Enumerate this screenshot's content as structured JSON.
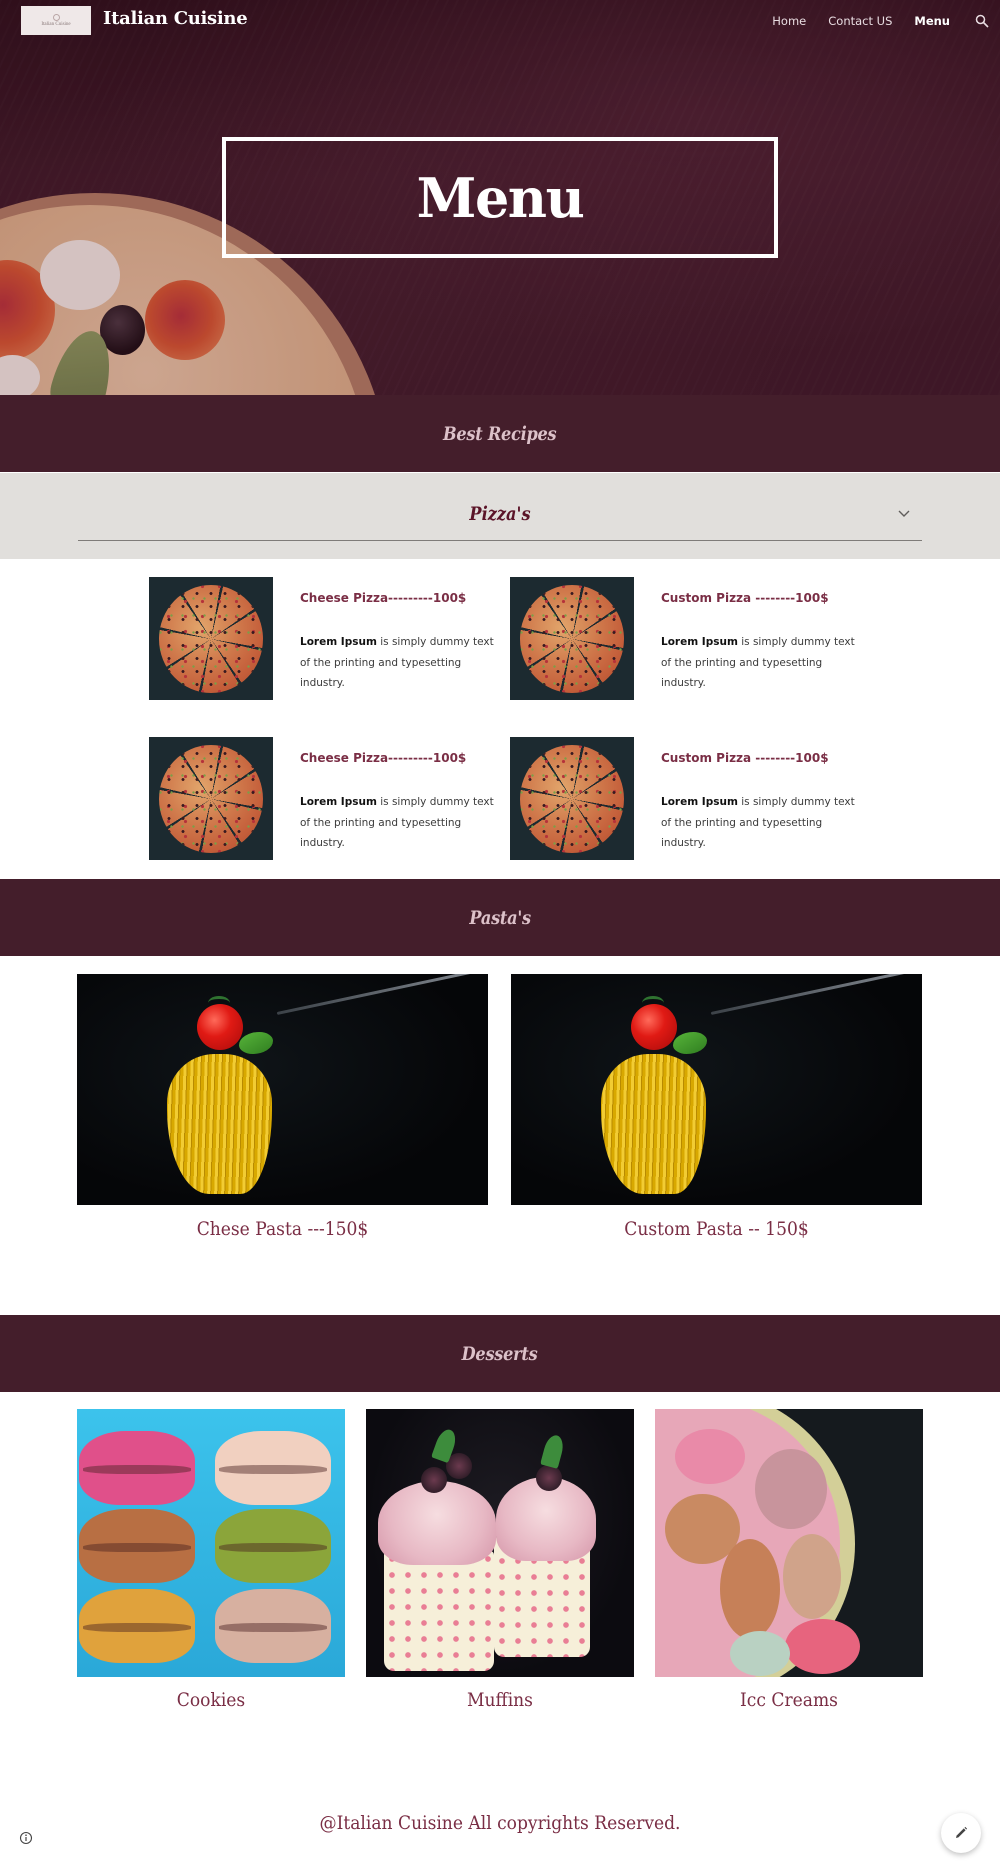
{
  "header": {
    "logo_text": "Italian Cuisine",
    "site_title": "Italian Cuisine",
    "nav": [
      {
        "label": "Home",
        "active": false
      },
      {
        "label": "Contact US",
        "active": false
      },
      {
        "label": "Menu",
        "active": true
      }
    ],
    "search_icon": "search-icon"
  },
  "hero": {
    "title": "Menu"
  },
  "sections": {
    "best_recipes": "Best Recipes",
    "pizzas": {
      "title": "Pizza's",
      "expand_icon": "chevron-down-icon",
      "items": [
        {
          "name": "Cheese Pizza---------100$",
          "desc_bold": "Lorem Ipsum",
          "desc_rest": " is simply dummy text of the printing and typesetting industry."
        },
        {
          "name": "Custom Pizza --------100$",
          "desc_bold": "Lorem Ipsum",
          "desc_rest": " is simply dummy text of the printing and typesetting industry."
        },
        {
          "name": "Cheese Pizza---------100$",
          "desc_bold": "Lorem Ipsum",
          "desc_rest": " is simply dummy text of the printing and typesetting industry."
        },
        {
          "name": "Custom Pizza --------100$",
          "desc_bold": "Lorem Ipsum",
          "desc_rest": " is simply dummy text of the printing and typesetting industry."
        }
      ]
    },
    "pastas": {
      "title": "Pasta's",
      "items": [
        {
          "caption": "Chese Pasta ---150$"
        },
        {
          "caption": "Custom Pasta -- 150$"
        }
      ]
    },
    "desserts": {
      "title": "Desserts",
      "items": [
        {
          "caption": "Cookies"
        },
        {
          "caption": "Muffins"
        },
        {
          "caption": "Icc Creams"
        }
      ]
    }
  },
  "footer": {
    "copyright": "@Italian Cuisine All copyrights Reserved.",
    "info_icon": "info-icon",
    "edit_icon": "pencil-icon"
  },
  "colors": {
    "band": "#441e2b",
    "accent_text": "#7a2e45",
    "accordion_bg": "#e1dfdc"
  }
}
